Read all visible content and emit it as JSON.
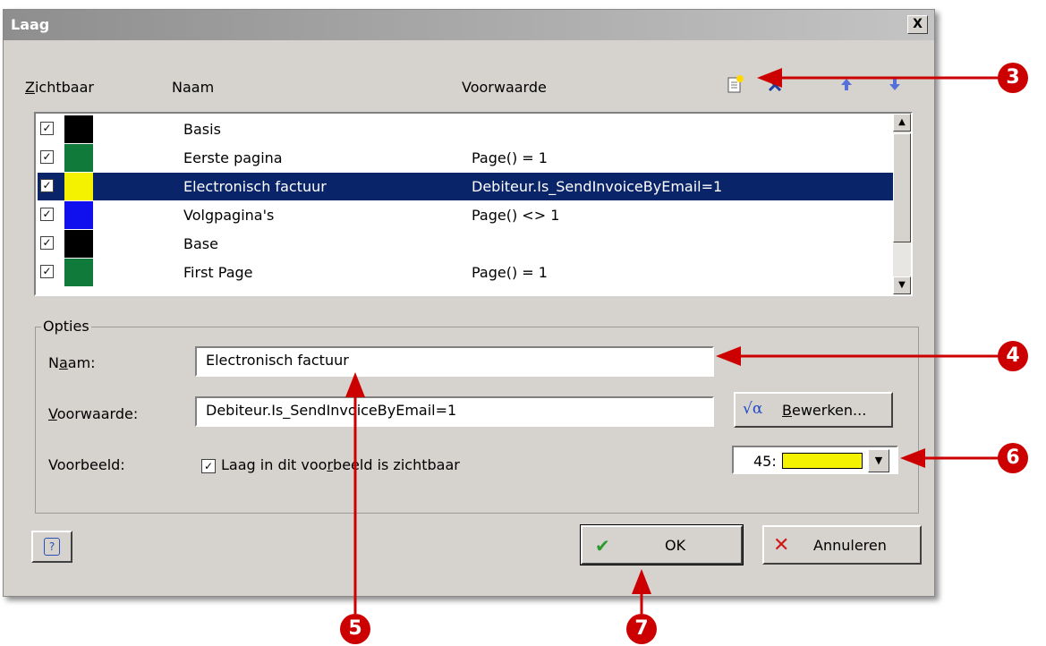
{
  "window": {
    "title": "Laag",
    "close_label": "X"
  },
  "columns": {
    "visible": "Zichtbaar",
    "name": "Naam",
    "condition": "Voorwaarde"
  },
  "layers": [
    {
      "name": "Basis",
      "condition": "",
      "color": "#000000",
      "checked": true
    },
    {
      "name": "Eerste pagina",
      "condition": "Page() = 1",
      "color": "#0f7a3a",
      "checked": true
    },
    {
      "name": "Electronisch factuur",
      "condition": "Debiteur.Is_SendInvoiceByEmail=1",
      "color": "#f5f200",
      "checked": true,
      "selected": true
    },
    {
      "name": "Volgpagina's",
      "condition": "Page() <> 1",
      "color": "#1010ee",
      "checked": true
    },
    {
      "name": "Base",
      "condition": "",
      "color": "#000000",
      "checked": true
    },
    {
      "name": "First Page",
      "condition": "Page() = 1",
      "color": "#0f7a3a",
      "checked": true
    }
  ],
  "options": {
    "legend": "Opties",
    "name_label": "Naam:",
    "name_value": "Electronisch factuur",
    "condition_label": "Voorwaarde:",
    "condition_value": "Debiteur.Is_SendInvoiceByEmail=1",
    "edit_button": "Bewerken...",
    "preview_label": "Voorbeeld:",
    "preview_checkbox_label": "Laag in dit voorbeeld is zichtbaar",
    "preview_checked": true,
    "color_value": "45:",
    "color_swatch": "#f5f200"
  },
  "buttons": {
    "help": "?",
    "ok": "OK",
    "cancel": "Annuleren"
  },
  "callouts": [
    "3",
    "4",
    "5",
    "6",
    "7"
  ],
  "colors": {
    "selection": "#0a246a",
    "callout": "#cc0000",
    "dialog": "#d6d3ce"
  }
}
